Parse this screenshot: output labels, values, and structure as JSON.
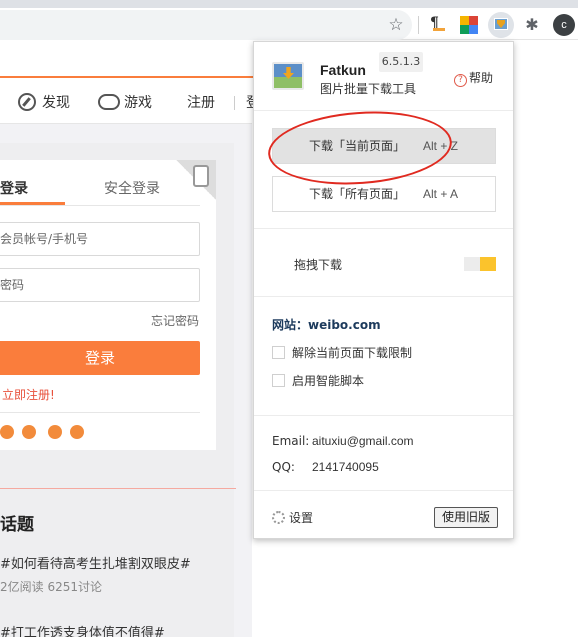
{
  "browser": {
    "profile_initial": "c",
    "pilcrow_glyph": "¶"
  },
  "page": {
    "nav": {
      "discover": "发现",
      "game": "游戏",
      "register": "注册",
      "login_trunc": "登"
    },
    "login": {
      "tab_login": "登录",
      "tab_secure": "安全登录",
      "account_placeholder": "会员帐号/手机号",
      "password_placeholder": "密码",
      "forgot": "忘记密码",
      "login_button": "登录",
      "register_now": "立即注册!"
    },
    "topics": {
      "heading": "话题",
      "items": [
        {
          "title": "#如何看待高考生扎堆割双眼皮#",
          "meta": "2亿阅读 6251讨论"
        },
        {
          "title": "#打工作透支身体值不值得#",
          "meta": ""
        }
      ]
    }
  },
  "popup": {
    "app_name": "Fatkun",
    "subtitle": "图片批量下载工具",
    "version": "6.5.1.3",
    "help": "帮助",
    "download_current_label": "下载「当前页面」",
    "download_current_key": "Alt + Z",
    "download_all_label": "下载「所有页面」",
    "download_all_key": "Alt + A",
    "drag_download": "拖拽下载",
    "site": "网站：weibo.com",
    "checkbox_remove_limit": "解除当前页面下载限制",
    "checkbox_smart_script": "启用智能脚本",
    "email_label": "Email:",
    "email_value": "aituxiu@gmail.com",
    "qq_label": "QQ:",
    "qq_value": "2141740095",
    "settings": "设置",
    "use_old_version": "使用旧版"
  },
  "colors": {
    "accent_orange": "#fa7d3c",
    "annotation_red": "#e02a20",
    "toggle_yellow": "#fbc32c"
  }
}
